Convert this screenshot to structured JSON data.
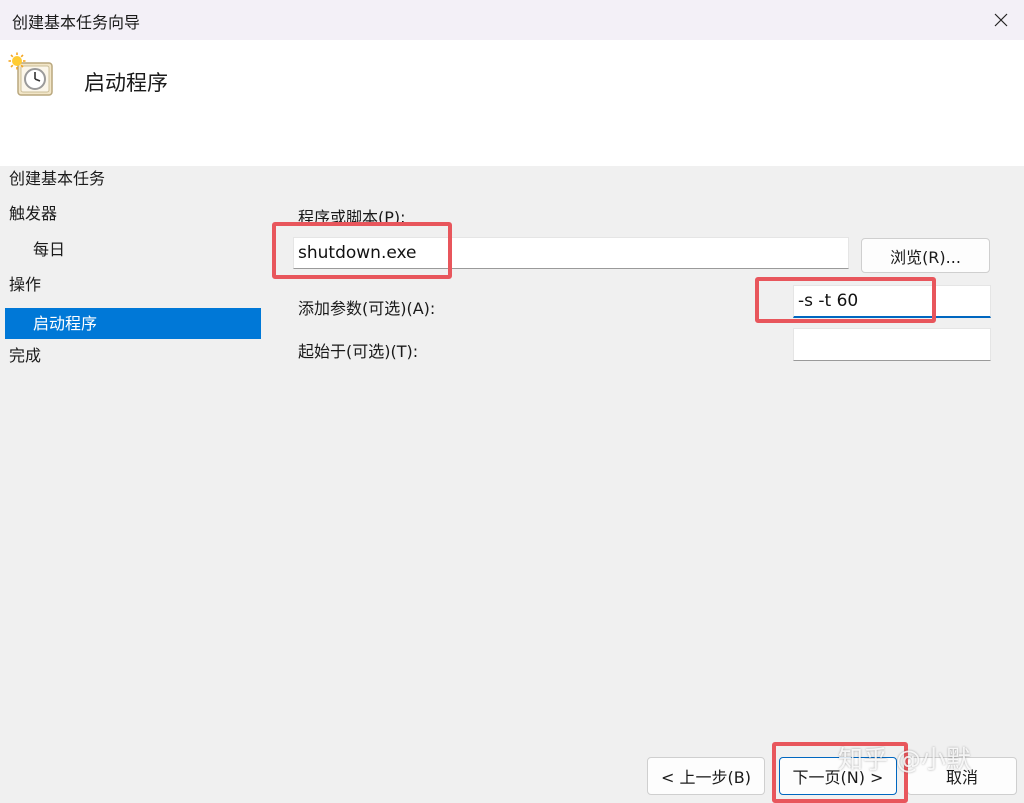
{
  "window": {
    "title": "创建基本任务向导"
  },
  "header": {
    "title": "启动程序",
    "icon": "task-clock-icon"
  },
  "nav": {
    "items": [
      {
        "label": "创建基本任务"
      },
      {
        "label": "触发器"
      },
      {
        "label": "每日"
      },
      {
        "label": "操作"
      },
      {
        "label": "启动程序"
      },
      {
        "label": "完成"
      }
    ],
    "active_index": 4
  },
  "form": {
    "program_label": "程序或脚本(P):",
    "program_value": "shutdown.exe",
    "browse_label": "浏览(R)...",
    "args_label": "添加参数(可选)(A):",
    "args_value": "-s -t 60",
    "start_label": "起始于(可选)(T):",
    "start_value": ""
  },
  "footer": {
    "back_label": "< 上一步(B)",
    "next_label": "下一页(N) >",
    "cancel_label": "取消"
  },
  "watermark": {
    "text": "知乎 @小默"
  },
  "colors": {
    "accent": "#0078d7",
    "highlight": "#e8565c"
  }
}
